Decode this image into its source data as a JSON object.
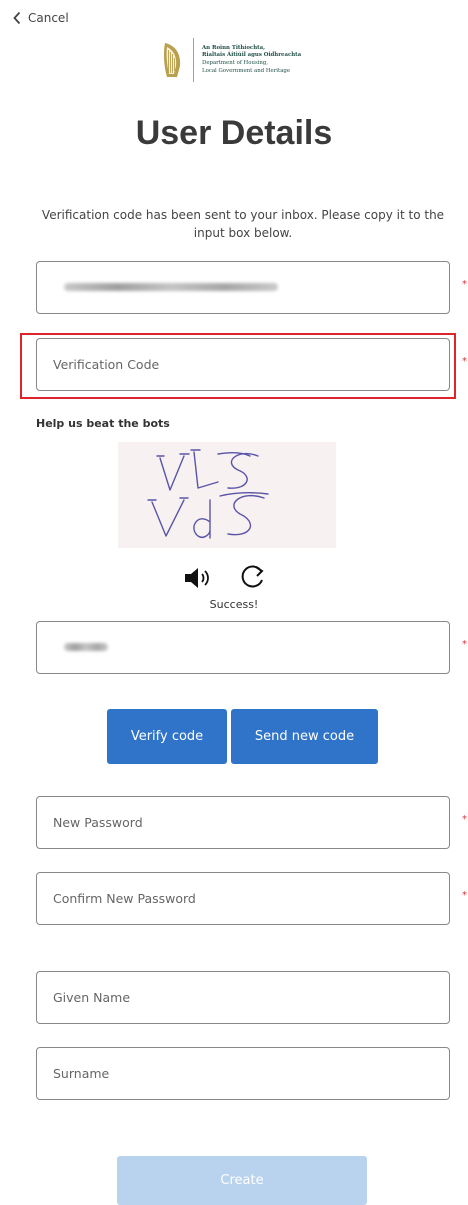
{
  "nav": {
    "cancel_label": "Cancel"
  },
  "logo": {
    "line1": "An Roinn Tithíochta,",
    "line2": "Rialtais Áitiúil agus Oidhreachta",
    "line3": "Department of Housing,",
    "line4": "Local Government and Heritage"
  },
  "header": {
    "title": "User Details"
  },
  "intro_text": "Verification code has been sent to your inbox. Please copy it to the input box below.",
  "fields": {
    "email": {
      "value": ""
    },
    "verification_code": {
      "placeholder": "Verification Code"
    },
    "captcha_answer": {
      "value": ""
    },
    "new_password": {
      "placeholder": "New Password"
    },
    "confirm_password": {
      "placeholder": "Confirm New Password"
    },
    "given_name": {
      "placeholder": "Given Name"
    },
    "surname": {
      "placeholder": "Surname"
    }
  },
  "captcha": {
    "label": "Help us beat the bots",
    "status": "Success!"
  },
  "buttons": {
    "verify_code": "Verify code",
    "send_new_code": "Send new code",
    "create": "Create"
  },
  "colors": {
    "primary_button": "#2f74c9",
    "disabled_button": "#b9d2ee",
    "highlight_border": "#e0242b",
    "required_marker": "#d63636"
  },
  "icons": {
    "back": "chevron-left-icon",
    "audio": "speaker-icon",
    "refresh": "refresh-icon",
    "emblem": "harp-icon"
  }
}
